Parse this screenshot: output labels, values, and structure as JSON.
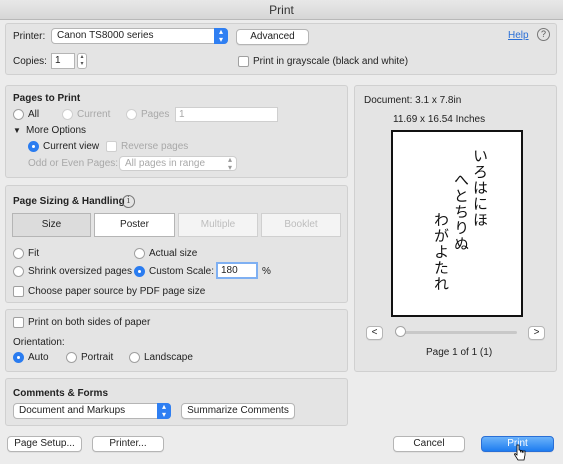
{
  "window": {
    "title": "Print"
  },
  "printer": {
    "label": "Printer:",
    "value": "Canon TS8000 series",
    "advanced_label": "Advanced",
    "help_label": "Help",
    "help_icon": "?"
  },
  "copies": {
    "label": "Copies:",
    "value": "1",
    "grayscale_label": "Print in grayscale (black and white)"
  },
  "pages_to_print": {
    "title": "Pages to Print",
    "all": "All",
    "current": "Current",
    "pages": "Pages",
    "pages_value": "1",
    "more_options": "More Options",
    "current_view": "Current view",
    "reverse_pages": "Reverse pages",
    "odd_even_label": "Odd or Even Pages:",
    "odd_even_value": "All pages in range"
  },
  "sizing": {
    "title": "Page Sizing & Handling",
    "info_icon": "i",
    "tabs": [
      "Size",
      "Poster",
      "Multiple",
      "Booklet"
    ],
    "fit": "Fit",
    "actual_size": "Actual size",
    "shrink": "Shrink oversized pages",
    "custom_scale": "Custom Scale:",
    "scale_value": "180",
    "percent": "%",
    "paper_source": "Choose paper source by PDF page size"
  },
  "both_sides": {
    "label": "Print on both sides of paper"
  },
  "orientation": {
    "label": "Orientation:",
    "auto": "Auto",
    "portrait": "Portrait",
    "landscape": "Landscape"
  },
  "comments": {
    "title": "Comments & Forms",
    "value": "Document and Markups",
    "summarize_label": "Summarize Comments"
  },
  "preview": {
    "document": "Document: 3.1 x 7.8in",
    "paper": "11.69 x 16.54 Inches",
    "columns": [
      "いろはにほ",
      "へとちりぬ",
      "わがよたれ"
    ],
    "prev": "<",
    "next": ">",
    "page_info": "Page 1 of 1 (1)"
  },
  "footer": {
    "page_setup": "Page Setup...",
    "printer": "Printer...",
    "cancel": "Cancel",
    "print": "Print"
  },
  "colors": {
    "accent": "#2a7cf0",
    "link": "#2a6fd6"
  }
}
